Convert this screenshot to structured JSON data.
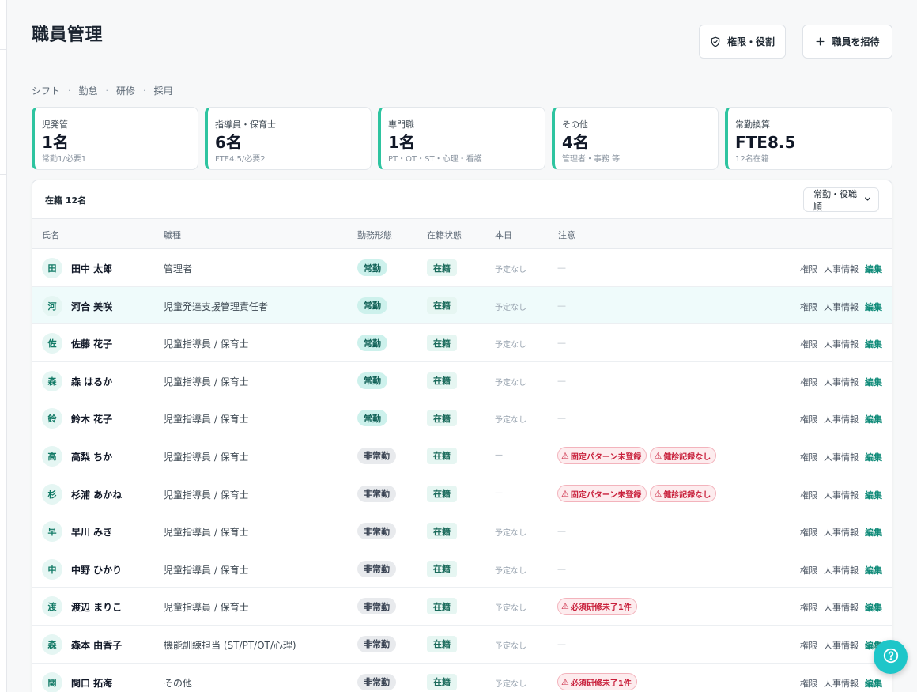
{
  "page": {
    "title": "職員管理"
  },
  "header": {
    "roles_label": "権限・役割",
    "invite_label": "職員を招待"
  },
  "subnav": [
    "シフト",
    "勤怠",
    "研修",
    "採用"
  ],
  "stats": [
    {
      "label": "児発管",
      "value": "1名",
      "sub": "常勤1/必要1"
    },
    {
      "label": "指導員・保育士",
      "value": "6名",
      "sub": "FTE4.5/必要2"
    },
    {
      "label": "専門職",
      "value": "1名",
      "sub": "PT・OT・ST・心理・看護"
    },
    {
      "label": "その他",
      "value": "4名",
      "sub": "管理者・事務 等"
    },
    {
      "label": "常勤換算",
      "value": "FTE8.5",
      "sub": "12名在籍"
    }
  ],
  "table": {
    "count_label": "在籍 12名",
    "sort_value": "常勤・役職順",
    "columns": [
      "氏名",
      "職種",
      "勤務形態",
      "在籍状態",
      "本日",
      "注意"
    ],
    "action_labels": {
      "permission": "権限",
      "hr": "人事情報",
      "edit": "編集"
    },
    "rows": [
      {
        "initial": "田",
        "name": "田中 太郎",
        "role": "管理者",
        "employment": "常勤",
        "type": "full",
        "status": "在籍",
        "today": "予定なし",
        "notes": []
      },
      {
        "initial": "河",
        "name": "河合 美咲",
        "role": "児童発達支援管理責任者",
        "employment": "常勤",
        "type": "full",
        "status": "在籍",
        "today": "予定なし",
        "notes": []
      },
      {
        "initial": "佐",
        "name": "佐藤 花子",
        "role": "児童指導員 / 保育士",
        "employment": "常勤",
        "type": "full",
        "status": "在籍",
        "today": "予定なし",
        "notes": []
      },
      {
        "initial": "森",
        "name": "森 はるか",
        "role": "児童指導員 / 保育士",
        "employment": "常勤",
        "type": "full",
        "status": "在籍",
        "today": "予定なし",
        "notes": []
      },
      {
        "initial": "鈴",
        "name": "鈴木 花子",
        "role": "児童指導員 / 保育士",
        "employment": "常勤",
        "type": "full",
        "status": "在籍",
        "today": "予定なし",
        "notes": []
      },
      {
        "initial": "高",
        "name": "高梨 ちか",
        "role": "児童指導員 / 保育士",
        "employment": "非常勤",
        "type": "part",
        "status": "在籍",
        "today": "—",
        "notes": [
          "固定パターン未登録",
          "健診記録なし"
        ]
      },
      {
        "initial": "杉",
        "name": "杉浦 あかね",
        "role": "児童指導員 / 保育士",
        "employment": "非常勤",
        "type": "part",
        "status": "在籍",
        "today": "—",
        "notes": [
          "固定パターン未登録",
          "健診記録なし"
        ]
      },
      {
        "initial": "早",
        "name": "早川 みき",
        "role": "児童指導員 / 保育士",
        "employment": "非常勤",
        "type": "part",
        "status": "在籍",
        "today": "予定なし",
        "notes": []
      },
      {
        "initial": "中",
        "name": "中野 ひかり",
        "role": "児童指導員 / 保育士",
        "employment": "非常勤",
        "type": "part",
        "status": "在籍",
        "today": "予定なし",
        "notes": []
      },
      {
        "initial": "渡",
        "name": "渡辺 まりこ",
        "role": "児童指導員 / 保育士",
        "employment": "非常勤",
        "type": "part",
        "status": "在籍",
        "today": "予定なし",
        "notes": [
          "必須研修未了1件"
        ]
      },
      {
        "initial": "森",
        "name": "森本 由香子",
        "role": "機能訓練担当 (ST/PT/OT/心理)",
        "employment": "非常勤",
        "type": "part",
        "status": "在籍",
        "today": "予定なし",
        "notes": []
      },
      {
        "initial": "関",
        "name": "関口 拓海",
        "role": "その他",
        "employment": "非常勤",
        "type": "part",
        "status": "在籍",
        "today": "予定なし",
        "notes": [
          "必須研修未了1件"
        ]
      }
    ]
  },
  "empty_mark": "—",
  "warning_glyph": "⚠",
  "colors": {
    "accent": "#2ec4a0",
    "fab": "#1ec6c9",
    "alert": "#c81e3a",
    "edit": "#0e8a78"
  },
  "icons": {
    "roles": "shield-check-icon",
    "invite": "plus-icon",
    "sort": "chevron-down-icon",
    "help": "question-circle-icon"
  }
}
